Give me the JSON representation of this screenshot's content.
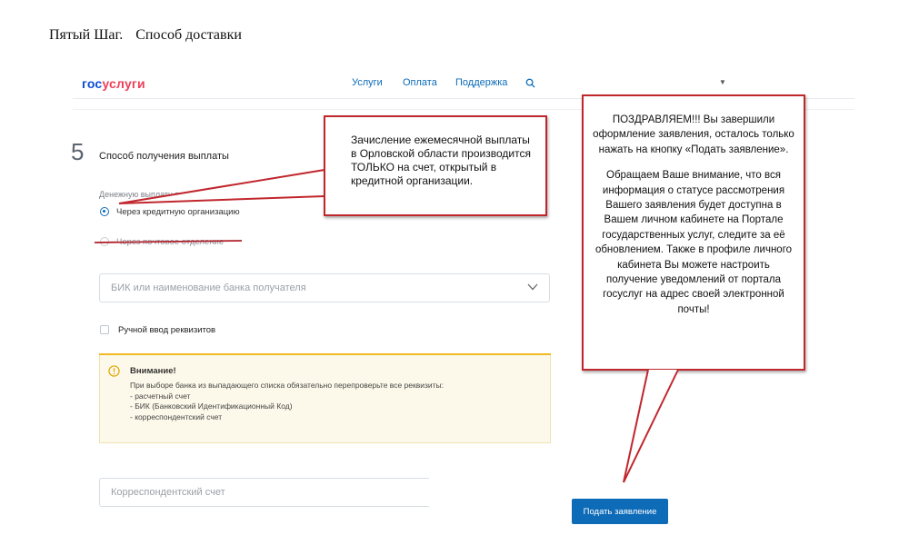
{
  "doc_title": {
    "step": "Пятый  Шаг.",
    "section": "Способ доставки"
  },
  "header": {
    "logo_gos": "гос",
    "logo_uslugi": "услуги",
    "nav": [
      "Услуги",
      "Оплата",
      "Поддержка"
    ]
  },
  "form": {
    "step_number": "5",
    "step_title": "Способ получения выплаты",
    "payment_label": "Денежную выплату прошу выплачивать",
    "option_bank": "Через кредитную организацию",
    "option_post": "Через почтовое отделение",
    "bank_placeholder": "БИК или наименование банка получателя",
    "manual_entry": "Ручной ввод реквизитов",
    "warning": {
      "title": "Внимание!",
      "lines": [
        "При выборе банка из выпадающего списка обязательно перепроверьте все реквизиты:",
        "- расчетный счет",
        "- БИК (Банковский Идентификационный Код)",
        "- корреспондентский счет"
      ]
    },
    "corr_placeholder": "Корреспондентский счет",
    "submit_label": "Подать заявление"
  },
  "callouts": {
    "payment_note": "Зачисление ежемесячной выплаты в Орловской области производится ТОЛЬКО на счет, открытый в кредитной организации.",
    "congrats": "ПОЗДРАВЛЯЕМ!!! Вы завершили оформление заявления, осталось только нажать на кнопку «Подать заявление».",
    "info": "Обращаем Ваше внимание, что вся информация о статусе рассмотрения Вашего заявления будет доступна в Вашем личном кабинете на Портале государственных услуг, следите за её обновлением. Также  в профиле личного кабинета Вы можете настроить получение уведомлений от портала госуслуг на адрес своей электронной почты!"
  },
  "colors": {
    "brand_blue": "#0d4cd3",
    "brand_red": "#ee3f58",
    "link_blue": "#0d6bb8",
    "callout_red": "#c0272d",
    "warning_yellow": "#f2b81f"
  }
}
